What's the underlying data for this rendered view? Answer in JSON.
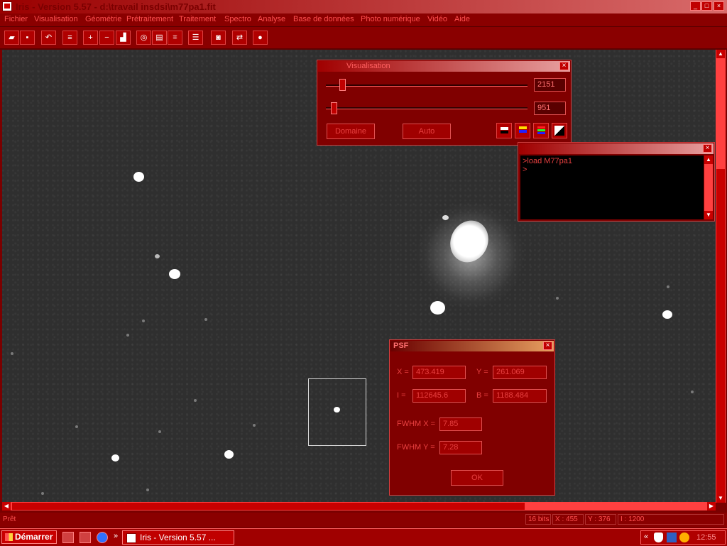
{
  "window": {
    "title": "Iris - Version 5.57 - d:\\travail insdsi\\m77pa1.fit"
  },
  "menu": [
    "Fichier",
    "Visualisation",
    "Géométrie",
    "Prétraitement",
    "Traitement",
    "Spectro",
    "Analyse",
    "Base de données",
    "Photo numérique",
    "Vidéo",
    "Aide"
  ],
  "visualisation": {
    "title": "Visualisation",
    "high_value": "2151",
    "low_value": "951",
    "domain_button": "Domaine",
    "auto_button": "Auto",
    "high_fraction": 0.08,
    "low_fraction": 0.04
  },
  "console": {
    "title": "",
    "lines": [
      ">load M77pa1",
      ">"
    ]
  },
  "psf": {
    "title": "PSF",
    "x_label": "X =",
    "x_value": "473.419",
    "y_label": "Y =",
    "y_value": "261.069",
    "i_label": "I =",
    "i_value": "112645.6",
    "b_label": "B =",
    "b_value": "1188.484",
    "fwhmx_label": "FWHM X =",
    "fwhmx_value": "7.85",
    "fwhmy_label": "FWHM Y =",
    "fwhmy_value": "7.28",
    "ok_button": "OK"
  },
  "status": {
    "ready": "Prêt",
    "bits": "16 bits",
    "x": "X : 455",
    "y": "Y : 376",
    "i": "I : 1200"
  },
  "taskbar": {
    "start": "Démarrer",
    "task": "Iris - Version 5.57 ...",
    "clock": "12:55"
  },
  "colors": {
    "accent": "#c00000",
    "panel": "#800000",
    "text": "#e84040"
  }
}
